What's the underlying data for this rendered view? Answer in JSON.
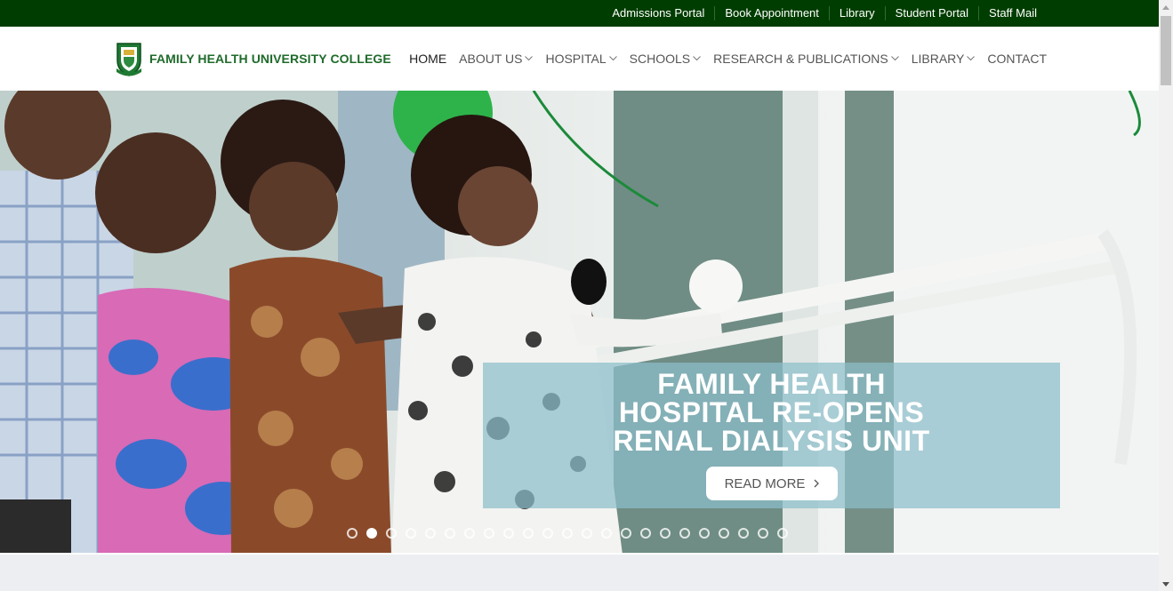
{
  "topbar": {
    "links": [
      "Admissions Portal",
      "Book Appointment",
      "Library",
      "Student Portal",
      "Staff Mail"
    ]
  },
  "header": {
    "logo_text": "FAMILY HEALTH UNIVERSITY COLLEGE",
    "nav": [
      {
        "label": "HOME",
        "dropdown": false,
        "active": true
      },
      {
        "label": "ABOUT US",
        "dropdown": true
      },
      {
        "label": "HOSPITAL",
        "dropdown": true
      },
      {
        "label": "SCHOOLS",
        "dropdown": true
      },
      {
        "label": "RESEARCH & PUBLICATIONS",
        "dropdown": true
      },
      {
        "label": "LIBRARY",
        "dropdown": true
      },
      {
        "label": "CONTACT",
        "dropdown": false
      }
    ]
  },
  "hero": {
    "title_lines": [
      "FAMILY HEALTH",
      "HOSPITAL RE-OPENS",
      "RENAL DIALYSIS UNIT"
    ],
    "button_label": "READ MORE",
    "slide_count": 23,
    "active_slide": 2
  },
  "colors": {
    "topbar": "#003d00",
    "brand_green": "#1f6b2b",
    "caption_bg": "#8cbeca"
  }
}
